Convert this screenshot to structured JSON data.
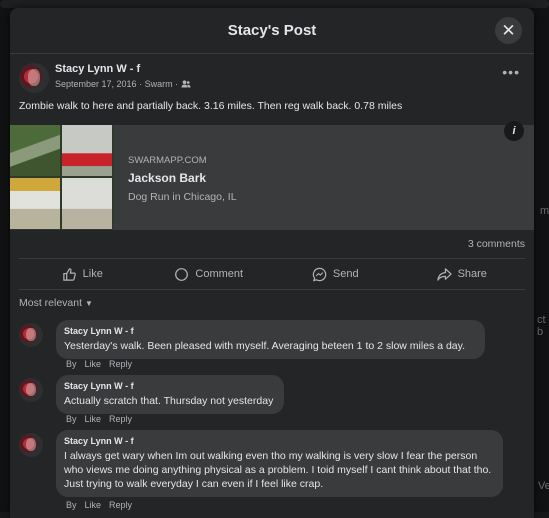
{
  "modal": {
    "title": "Stacy's Post",
    "close_glyph": "✕"
  },
  "post": {
    "author": "Stacy Lynn W - f",
    "date": "September 17, 2016",
    "sep": "·",
    "source": "Swarm",
    "audience_icon": "friends-icon",
    "more_glyph": "•••",
    "text": "Zombie walk to here and partially back. 3.16 miles. Then reg walk back. 0.78 miles"
  },
  "link_card": {
    "domain": "SWARMAPP.COM",
    "title": "Jackson Bark",
    "subtitle": "Dog Run in Chicago, IL",
    "info_glyph": "i"
  },
  "stats": {
    "comments": "3 comments"
  },
  "actions": {
    "like": "Like",
    "comment": "Comment",
    "send": "Send",
    "share": "Share"
  },
  "filter": {
    "label": "Most relevant",
    "chevron": "▼"
  },
  "comments": [
    {
      "author": "Stacy Lynn W - f",
      "text": "Yesterday's walk. Been pleased with myself. Averaging beteen 1 to 2 slow miles a day.",
      "by": "By",
      "like": "Like",
      "reply": "Reply"
    },
    {
      "author": "Stacy Lynn W - f",
      "text": "Actually scratch that. Thursday not yesterday",
      "by": "By",
      "like": "Like",
      "reply": "Reply"
    },
    {
      "author": "Stacy Lynn W - f",
      "text": "I always get wary when Im out walking even tho my walking is very slow I fear the person who views me doing anything physical as a problem. I toid myself I cant think about that tho. Just trying to walk everyday I can even if I feel like crap.",
      "by": "By",
      "like": "Like",
      "reply": "Reply"
    }
  ],
  "background": {
    "right_fragment_1": "ct b",
    "right_fragment_2": "m",
    "right_fragment_3": "Ve"
  }
}
